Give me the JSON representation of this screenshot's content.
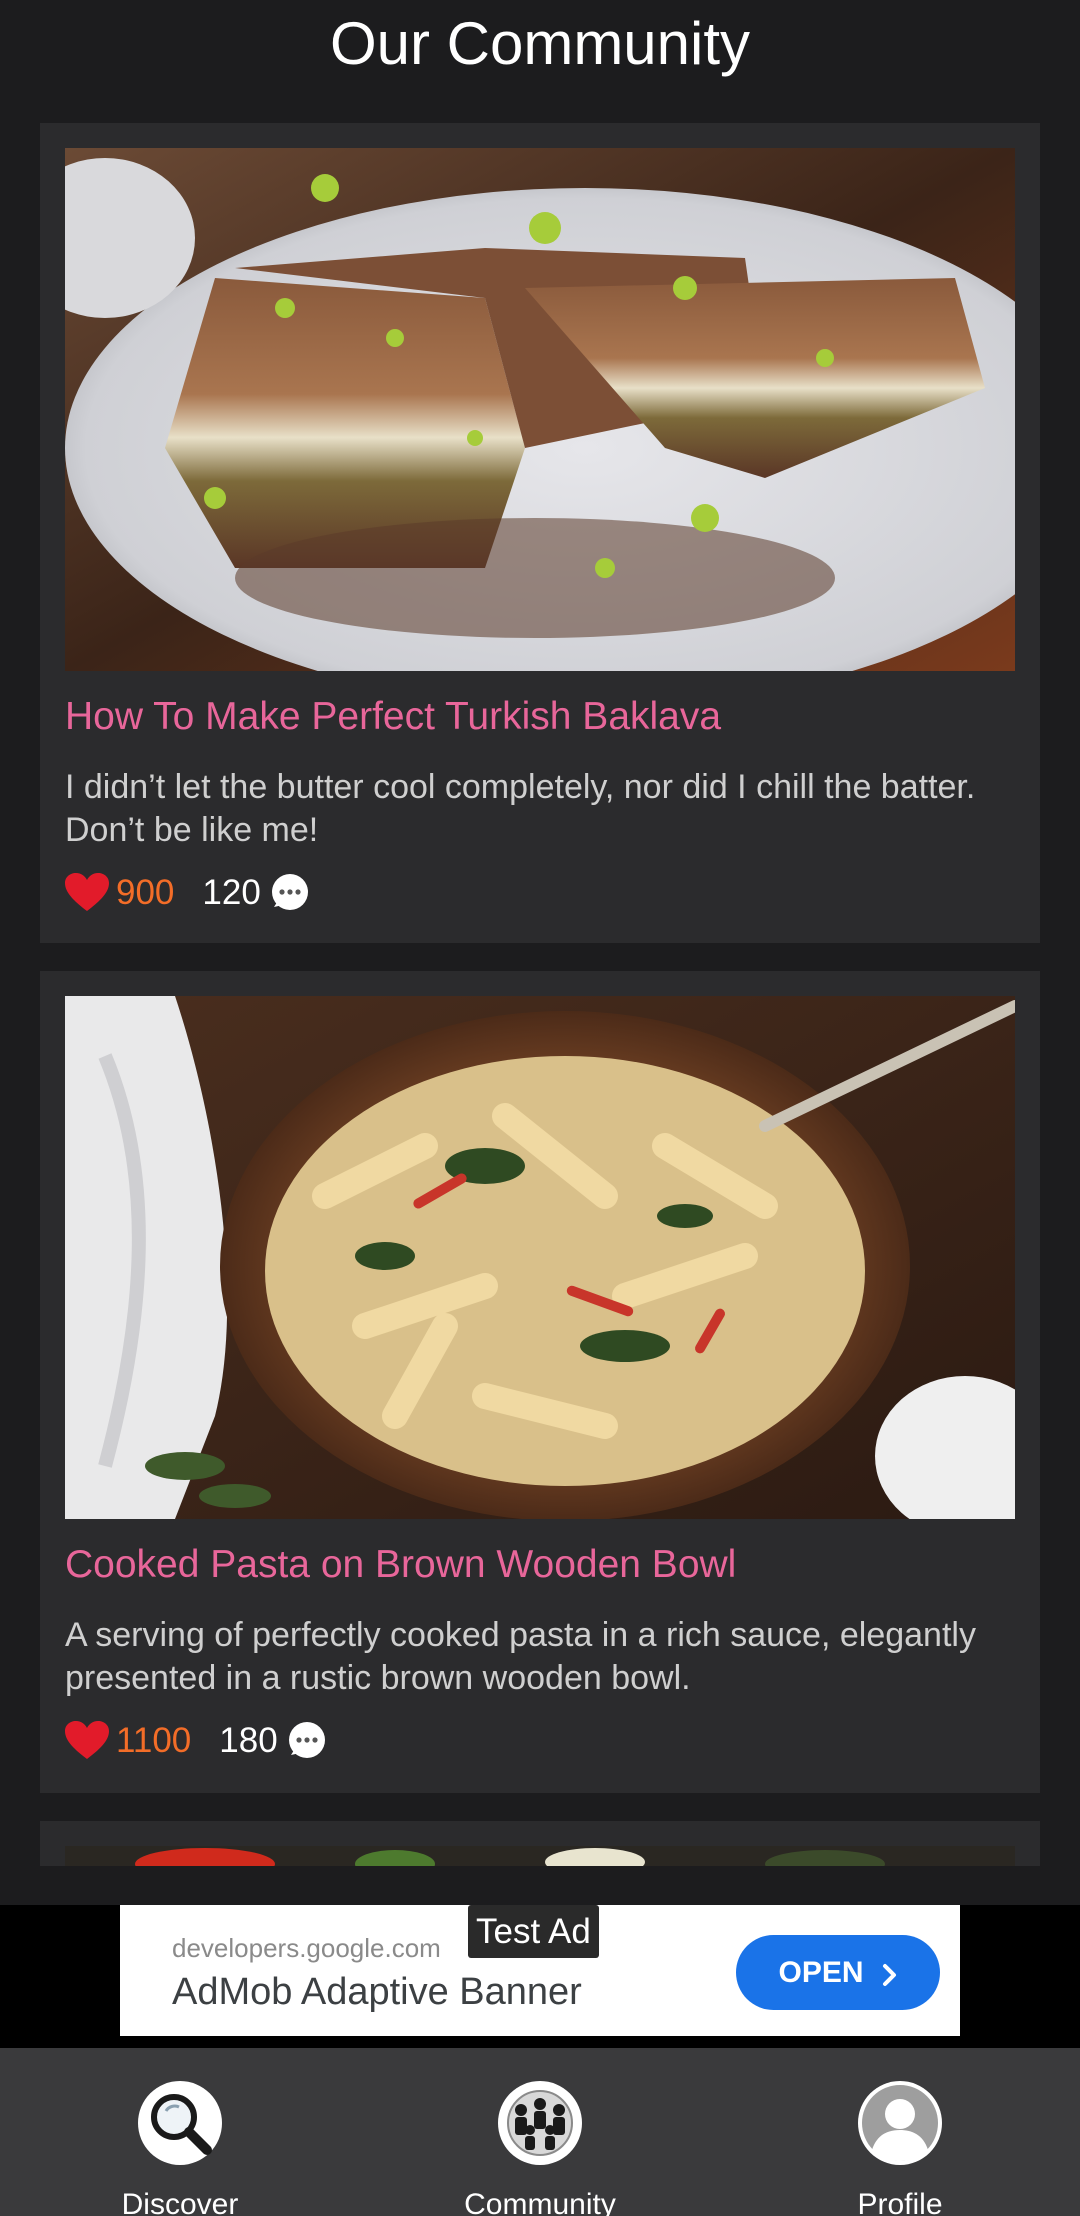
{
  "header": {
    "title": "Our Community"
  },
  "posts": [
    {
      "title": "How To Make Perfect Turkish Baklava",
      "description": "I didn’t let the butter cool completely, nor did I chill the batter. Don’t be like me!",
      "likes": "900",
      "comments": "120",
      "image": "baklava-photo"
    },
    {
      "title": "Cooked Pasta on Brown Wooden Bowl",
      "description": "A serving of perfectly cooked pasta in a rich sauce, elegantly presented in a rustic brown wooden bowl.",
      "likes": "1100",
      "comments": "180",
      "image": "pasta-photo"
    }
  ],
  "ad": {
    "tag": "Test Ad",
    "domain": "developers.google.com",
    "headline": "AdMob Adaptive Banner",
    "cta": "OPEN"
  },
  "nav": {
    "items": [
      {
        "label": "Discover",
        "icon": "magnifier-icon"
      },
      {
        "label": "Community",
        "icon": "people-globe-icon"
      },
      {
        "label": "Profile",
        "icon": "user-avatar-icon"
      }
    ]
  },
  "colors": {
    "background": "#1c1c1e",
    "card": "#2b2b2d",
    "title_pink": "#e8669a",
    "likes_orange": "#f36d28",
    "ad_button_blue": "#1a73e8",
    "nav_bar": "#3a3a3c"
  }
}
